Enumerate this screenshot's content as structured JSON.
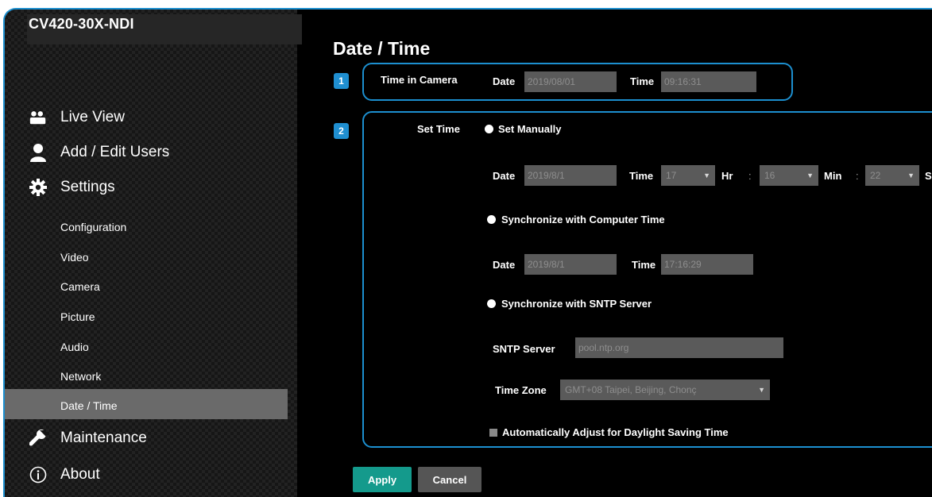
{
  "app": {
    "model_name": "CV420-30X-NDI"
  },
  "sidebar": {
    "nav": [
      {
        "label": "Live View",
        "icon": "live-view-icon"
      },
      {
        "label": "Add / Edit Users",
        "icon": "user-icon"
      },
      {
        "label": "Settings",
        "icon": "gear-icon"
      },
      {
        "label": "Maintenance",
        "icon": "wrench-icon"
      },
      {
        "label": "About",
        "icon": "info-icon"
      }
    ],
    "settings_items": [
      "Configuration",
      "Video",
      "Camera",
      "Picture",
      "Audio",
      "Network",
      "Date / Time"
    ],
    "active_item": "Date / Time"
  },
  "main": {
    "title": "Date / Time",
    "section1": {
      "badge": "1",
      "label": "Time in Camera",
      "date_label": "Date",
      "date_value": "2019/08/01",
      "time_label": "Time",
      "time_value": "09:16:31"
    },
    "section2": {
      "badge": "2",
      "label": "Set Time",
      "manual": {
        "option": "Set Manually",
        "date_label": "Date",
        "date_value": "2019/8/1",
        "time_label": "Time",
        "hour": "17",
        "hr_label": "Hr",
        "sep1": ":",
        "minute": "16",
        "min_label": "Min",
        "sep2": ":",
        "second": "22",
        "sec_label": "S"
      },
      "computer": {
        "option": "Synchronize with Computer Time",
        "date_label": "Date",
        "date_value": "2019/8/1",
        "time_label": "Time",
        "time_value": "17:16:29"
      },
      "sntp": {
        "option": "Synchronize with SNTP Server",
        "server_label": "SNTP Server",
        "server_value": "pool.ntp.org",
        "zone_label": "Time Zone",
        "zone_value": "GMT+08 Taipei, Beijing, Chonç"
      },
      "dst_label": "Automatically Adjust for Daylight Saving Time"
    },
    "buttons": {
      "apply": "Apply",
      "cancel": "Cancel"
    }
  },
  "colors": {
    "accent": "#1c8fcf",
    "apply_button": "#149a8c",
    "cancel_button": "#555555",
    "field_bg": "#5a5a5a"
  }
}
